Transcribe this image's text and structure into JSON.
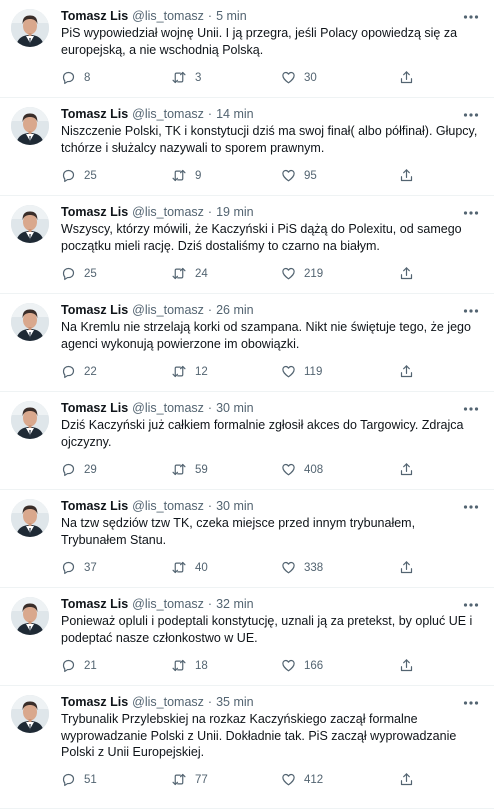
{
  "tweets": [
    {
      "name": "Tomasz Lis",
      "handle": "@lis_tomasz",
      "time": "5 min",
      "text": "PiS wypowiedział wojnę Unii. I ją przegra, jeśli Polacy opowiedzą się za europejską, a nie wschodnią Polską.",
      "replies": "8",
      "retweets": "3",
      "likes": "30"
    },
    {
      "name": "Tomasz Lis",
      "handle": "@lis_tomasz",
      "time": "14 min",
      "text": "Niszczenie Polski, TK i konstytucji dziś ma swoj finał( albo półfinał). Głupcy, tchórze i służalcy nazywali to sporem prawnym.",
      "replies": "25",
      "retweets": "9",
      "likes": "95"
    },
    {
      "name": "Tomasz Lis",
      "handle": "@lis_tomasz",
      "time": "19 min",
      "text": "Wszyscy, którzy mówili, że Kaczyński i PiS dążą do Polexitu, od samego początku mieli rację. Dziś dostaliśmy to czarno na białym.",
      "replies": "25",
      "retweets": "24",
      "likes": "219"
    },
    {
      "name": "Tomasz Lis",
      "handle": "@lis_tomasz",
      "time": "26 min",
      "text": "Na Kremlu nie strzelają korki od szampana. Nikt nie świętuje tego, że jego agenci wykonują powierzone im obowiązki.",
      "replies": "22",
      "retweets": "12",
      "likes": "119"
    },
    {
      "name": "Tomasz Lis",
      "handle": "@lis_tomasz",
      "time": "30 min",
      "text": "Dziś Kaczyński już całkiem formalnie zgłosił akces do Targowicy. Zdrajca ojczyzny.",
      "replies": "29",
      "retweets": "59",
      "likes": "408"
    },
    {
      "name": "Tomasz Lis",
      "handle": "@lis_tomasz",
      "time": "30 min",
      "text": "Na tzw sędziów tzw TK, czeka miejsce przed innym trybunałem, Trybunałem Stanu.",
      "replies": "37",
      "retweets": "40",
      "likes": "338"
    },
    {
      "name": "Tomasz Lis",
      "handle": "@lis_tomasz",
      "time": "32 min",
      "text": "Ponieważ opluli i podeptali konstytucję, uznali ją za pretekst, by opluć UE i podeptać nasze członkostwo w UE.",
      "replies": "21",
      "retweets": "18",
      "likes": "166"
    },
    {
      "name": "Tomasz Lis",
      "handle": "@lis_tomasz",
      "time": "35 min",
      "text": "Trybunalik Przylebskiej na rozkaz Kaczyńskiego zaczął formalne wyprowadzanie Polski z Unii. Dokładnie  tak. PiS zaczął wyprowadzanie Polski z Unii Europejskiej.",
      "replies": "51",
      "retweets": "77",
      "likes": "412"
    }
  ]
}
